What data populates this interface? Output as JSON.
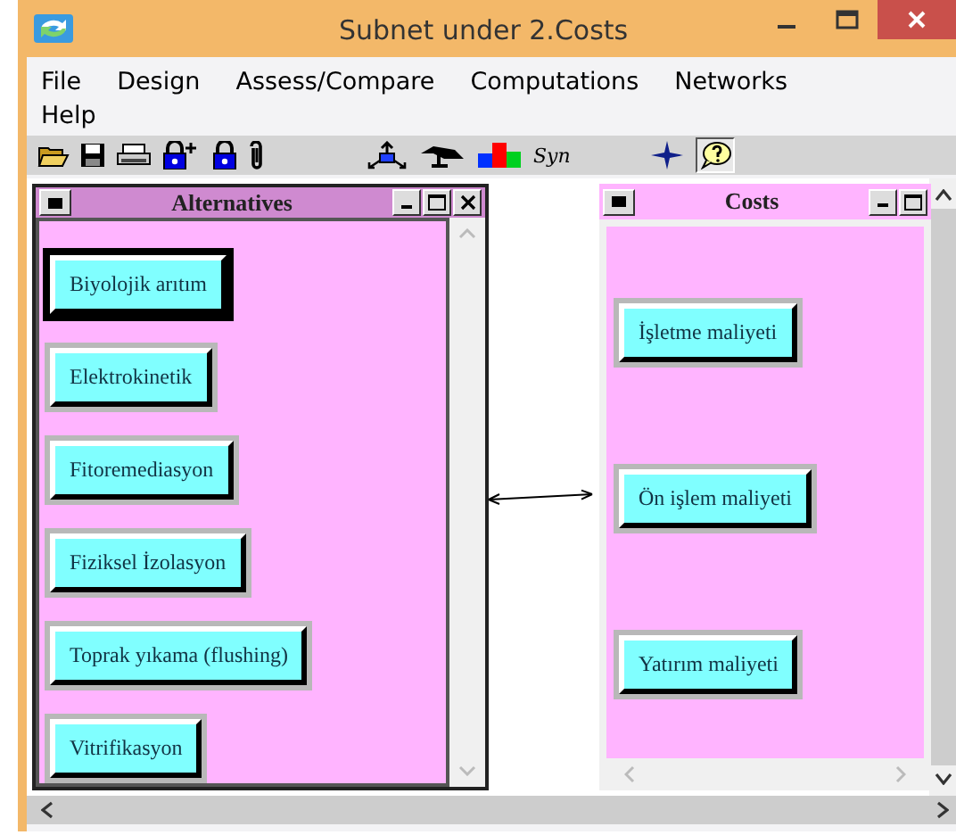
{
  "window": {
    "title": "Subnet under 2.Costs"
  },
  "menu": [
    "File",
    "Design",
    "Assess/Compare",
    "Computations",
    "Networks",
    "Help"
  ],
  "toolbar": {
    "syn_label": "Syn",
    "help_pressed": true
  },
  "subwindows": [
    {
      "title": "Alternatives",
      "active": true,
      "closable": true,
      "nodes": [
        {
          "label": "Biyolojik arıtım",
          "selected": true
        },
        {
          "label": "Elektrokinetik",
          "selected": false
        },
        {
          "label": "Fitoremediasyon",
          "selected": false
        },
        {
          "label": "Fiziksel İzolasyon",
          "selected": false
        },
        {
          "label": "Toprak yıkama (flushing)",
          "selected": false
        },
        {
          "label": "Vitrifikasyon",
          "selected": false
        }
      ]
    },
    {
      "title": "Costs",
      "active": false,
      "closable": false,
      "nodes": [
        {
          "label": "İşletme maliyeti",
          "selected": false
        },
        {
          "label": "Ön işlem maliyeti",
          "selected": false
        },
        {
          "label": "Yatırım maliyeti",
          "selected": false
        }
      ]
    }
  ]
}
